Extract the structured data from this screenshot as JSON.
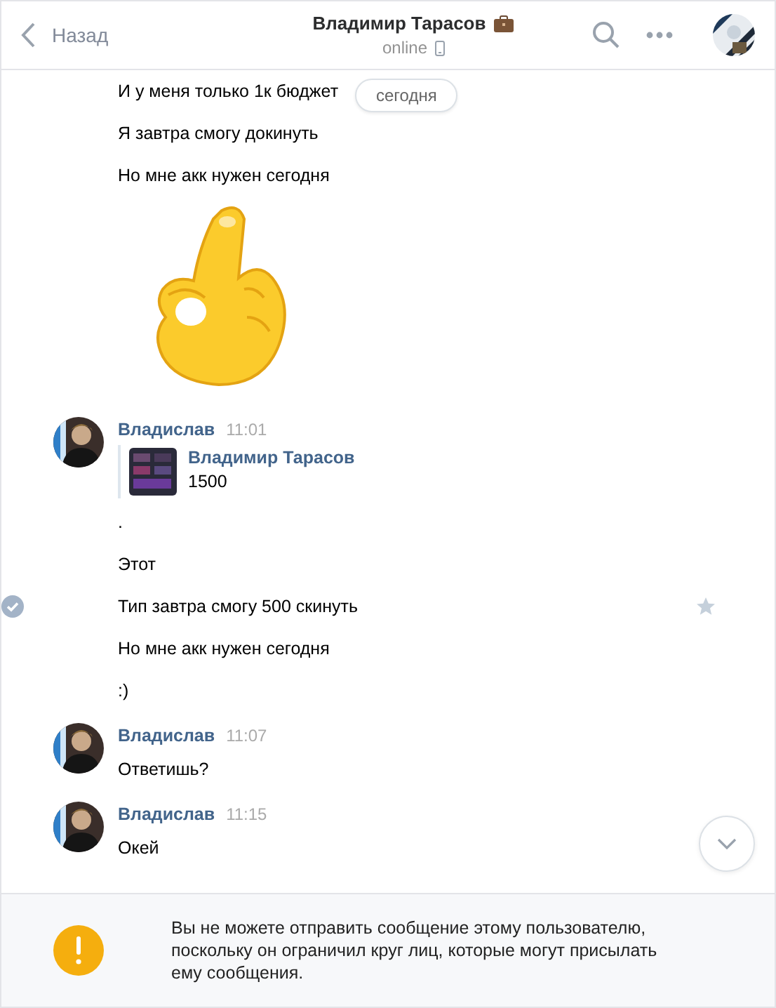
{
  "header": {
    "back": "Назад",
    "title": "Владимир Тарасов",
    "status": "online"
  },
  "date_badge": "сегодня",
  "groups": [
    {
      "items": [
        {
          "kind": "text",
          "text": "И у меня только 1к бюджет",
          "selected": false
        },
        {
          "kind": "text",
          "text": "Я завтра смогу докинуть",
          "selected": false
        },
        {
          "kind": "text",
          "text": "Но мне акк нужен сегодня",
          "selected": false
        },
        {
          "kind": "sticker",
          "selected": false
        }
      ]
    },
    {
      "author": "Владислав",
      "time": "11:01",
      "items": [
        {
          "kind": "forward",
          "author": "Владимир Тарасов",
          "text": "1500",
          "selected": false
        },
        {
          "kind": "text",
          "text": ".",
          "selected": false
        },
        {
          "kind": "text",
          "text": "Этот",
          "selected": false
        },
        {
          "kind": "text",
          "text": "Тип завтра смогу 500 скинуть",
          "selected": true
        },
        {
          "kind": "text",
          "text": "Но мне акк нужен сегодня",
          "selected": false
        },
        {
          "kind": "text",
          "text": ":)",
          "selected": false
        }
      ]
    },
    {
      "author": "Владислав",
      "time": "11:07",
      "items": [
        {
          "kind": "text",
          "text": "Ответишь?",
          "selected": false
        }
      ]
    },
    {
      "author": "Владислав",
      "time": "11:15",
      "items": [
        {
          "kind": "text",
          "text": "Окей",
          "selected": false
        }
      ]
    }
  ],
  "notice": "Вы не можете отправить сообщение этому пользователю, поскольку он ограничил круг лиц, которые могут присылать ему сообщения."
}
